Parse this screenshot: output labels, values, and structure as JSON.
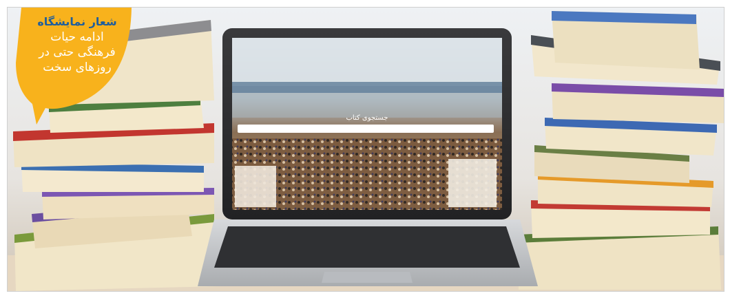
{
  "badge": {
    "title": "شعار نمایشگاه",
    "lines": [
      "ادامه حیات",
      "فرهنگی حتی در",
      "روزهای سخت"
    ]
  },
  "screen": {
    "title": "جستجوی کتاب"
  },
  "colors": {
    "badge": "#f8b21c",
    "badge_title": "#1f5e9c",
    "laptop": "#2a2a2c",
    "keyboard": "#c9cbce"
  }
}
